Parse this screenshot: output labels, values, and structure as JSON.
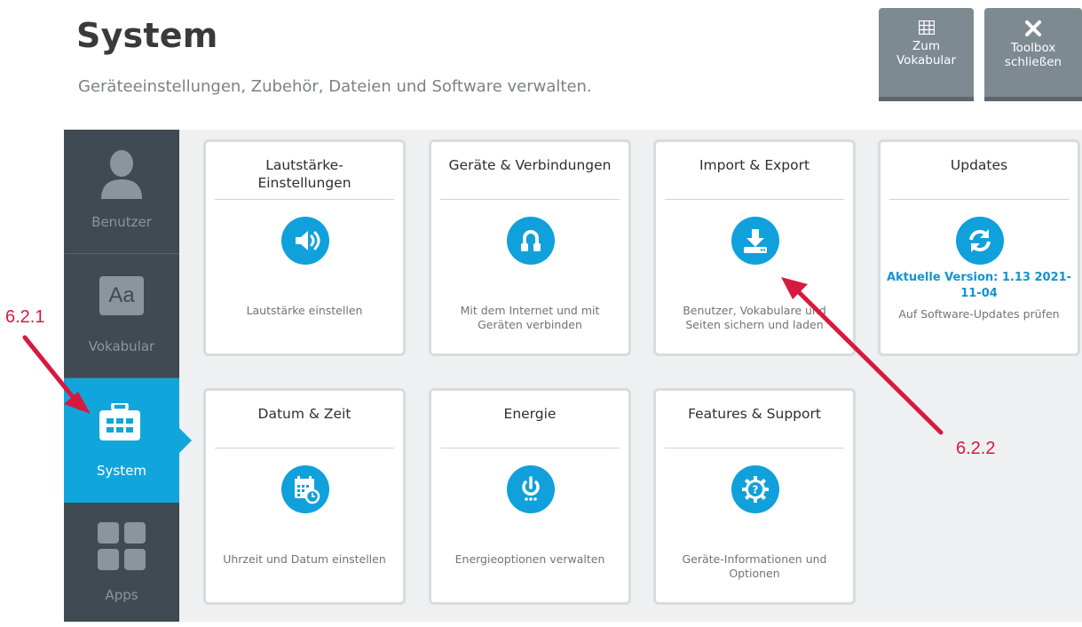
{
  "header": {
    "title": "System",
    "subtitle": "Geräteeinstellungen, Zubehör, Dateien und Software verwalten."
  },
  "toolbar": {
    "vocab_label": "Zum\nVokabular",
    "close_label": "Toolbox\nschließen"
  },
  "sidebar": {
    "items": [
      {
        "label": "Benutzer",
        "icon": "user-icon"
      },
      {
        "label": "Vokabular",
        "icon": "vocabulary-aa-icon"
      },
      {
        "label": "System",
        "icon": "toolbox-icon",
        "active": true
      },
      {
        "label": "Apps",
        "icon": "apps-grid-icon"
      }
    ]
  },
  "cards": [
    {
      "title": "Lautstärke-\nEinstellungen",
      "icon": "speaker-icon",
      "desc": "Lautstärke einstellen"
    },
    {
      "title": "Geräte & Verbindungen",
      "icon": "connection-icon",
      "desc": "Mit dem Internet und mit\nGeräten verbinden"
    },
    {
      "title": "Import & Export",
      "icon": "download-icon",
      "desc": "Benutzer, Vokabulare und\nSeiten sichern und laden"
    },
    {
      "title": "Updates",
      "icon": "refresh-icon",
      "version": "Aktuelle Version: 1.13 2021-\n11-04",
      "desc": "Auf Software-Updates prüfen"
    },
    {
      "title": "Datum & Zeit",
      "icon": "calendar-clock-icon",
      "desc": "Uhrzeit und Datum einstellen"
    },
    {
      "title": "Energie",
      "icon": "power-icon",
      "desc": "Energieoptionen verwalten"
    },
    {
      "title": "Features & Support",
      "icon": "gear-help-icon",
      "desc": "Geräte-Informationen und\nOptionen"
    }
  ],
  "annotations": {
    "a1": "6.2.1",
    "a2": "6.2.2"
  },
  "colors": {
    "accent": "#10a6dc",
    "sidebar": "#404a52",
    "annotation": "#d8193f",
    "toolbar_button": "#7e8a92"
  }
}
